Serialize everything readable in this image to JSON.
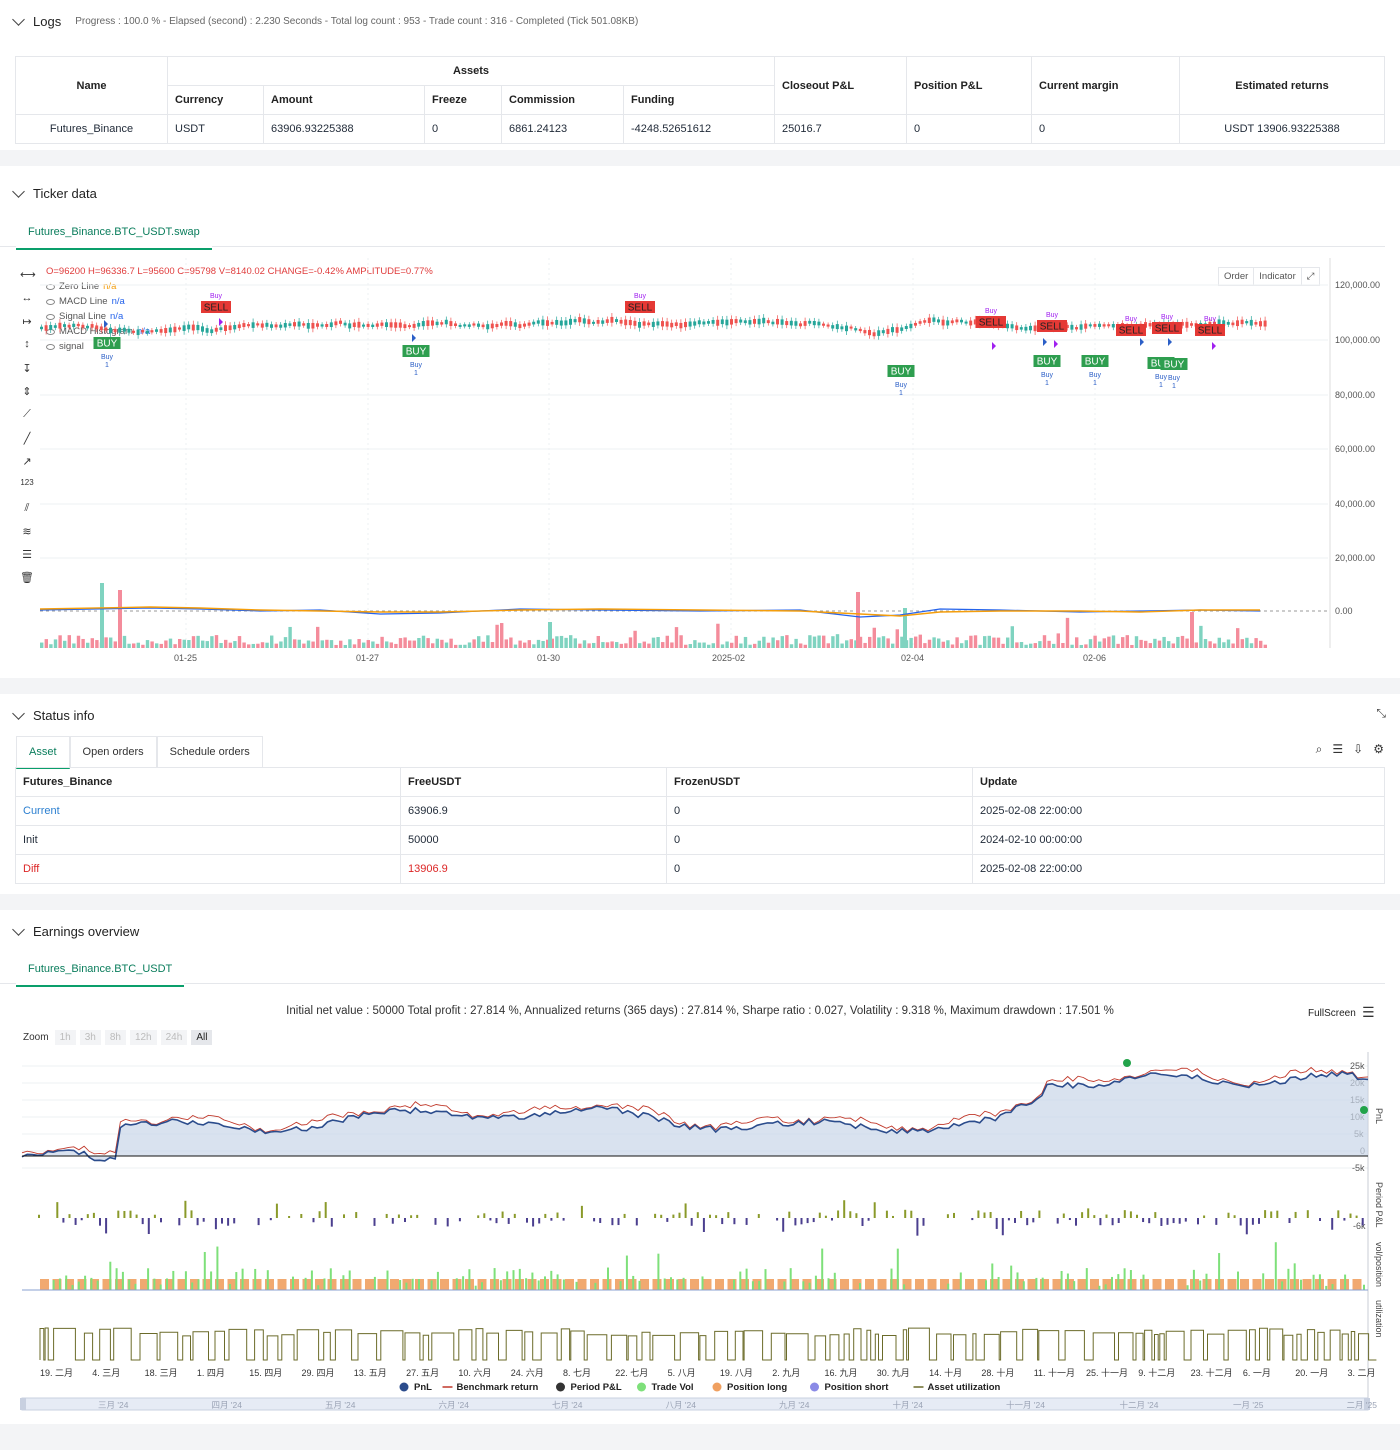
{
  "logs": {
    "title": "Logs",
    "status": "Progress : 100.0 % - Elapsed (second) : 2.230  Seconds - Total log count : 953 - Trade count : 316 - Completed (Tick 501.08KB)"
  },
  "assets_table": {
    "group_header": "Assets",
    "headers": {
      "name": "Name",
      "currency": "Currency",
      "amount": "Amount",
      "freeze": "Freeze",
      "commission": "Commission",
      "funding": "Funding",
      "closeout": "Closeout P&L",
      "position": "Position P&L",
      "margin": "Current margin",
      "returns": "Estimated returns"
    },
    "row": {
      "name": "Futures_Binance",
      "currency": "USDT",
      "amount": "63906.93225388",
      "freeze": "0",
      "commission": "6861.24123",
      "funding": "-4248.52651612",
      "closeout": "25016.7",
      "position": "0",
      "margin": "0",
      "returns": "USDT 13906.93225388"
    }
  },
  "ticker": {
    "title": "Ticker data",
    "tab": "Futures_Binance.BTC_USDT.swap",
    "ohlc": "O=96200 H=96336.7 L=95600 C=95798 V=8140.02 CHANGE=-0.42% AMPLITUDE=0.77%",
    "legend": [
      {
        "label": "Zero Line",
        "value": "n/a",
        "color": "#f59e0b"
      },
      {
        "label": "MACD Line",
        "value": "n/a",
        "color": "#2563eb"
      },
      {
        "label": "Signal Line",
        "value": "n/a",
        "color": "#2563eb"
      },
      {
        "label": "MACD Histogram",
        "value": "n/a",
        "color": "#2563eb"
      },
      {
        "label": "signal",
        "value": "",
        "color": "#555"
      }
    ],
    "buttons": {
      "order": "Order",
      "indicator": "Indicator"
    },
    "y_ticks": [
      "120,000.00",
      "100,000.00",
      "80,000.00",
      "60,000.00",
      "40,000.00",
      "20,000.00",
      "0.00"
    ],
    "x_ticks": [
      "01-25",
      "01-27",
      "01-30",
      "2025-02",
      "02-04",
      "02-06"
    ],
    "labels": {
      "buy": "BUY",
      "sell": "SELL",
      "buy_small": "Buy",
      "one": "1"
    }
  },
  "status": {
    "title": "Status info",
    "tabs": [
      "Asset",
      "Open orders",
      "Schedule orders"
    ],
    "headers": [
      "Futures_Binance",
      "FreeUSDT",
      "FrozenUSDT",
      "Update"
    ],
    "rows": [
      {
        "name": "Current",
        "free": "63906.9",
        "frozen": "0",
        "update": "2025-02-08 22:00:00"
      },
      {
        "name": "Init",
        "free": "50000",
        "frozen": "0",
        "update": "2024-02-10 00:00:00"
      },
      {
        "name": "Diff",
        "free": "13906.9",
        "frozen": "0",
        "update": "2025-02-08 22:00:00"
      }
    ]
  },
  "earnings": {
    "title": "Earnings overview",
    "tab": "Futures_Binance.BTC_USDT",
    "summary": "Initial net value : 50000  Total profit : 27.814 %, Annualized returns (365 days) : 27.814 %, Sharpe ratio : 0.027, Volatility : 9.318 %, Maximum drawdown : 17.501 %",
    "fullscreen": "FullScreen",
    "zoom_label": "Zoom",
    "zoom": [
      "1h",
      "3h",
      "8h",
      "12h",
      "24h",
      "All"
    ],
    "pnl_ticks": [
      "25k",
      "20k",
      "15k",
      "10k",
      "5k",
      "0",
      "-5k"
    ],
    "pnl_axis": "PnL",
    "period_axis": "Period P&L",
    "period_tick": "-6k",
    "vol_axis": "vol/position",
    "util_axis": "utilization",
    "x_ticks": [
      "19. 二月",
      "4. 三月",
      "18. 三月",
      "1. 四月",
      "15. 四月",
      "29. 四月",
      "13. 五月",
      "27. 五月",
      "10. 六月",
      "24. 六月",
      "8. 七月",
      "22. 七月",
      "5. 八月",
      "19. 八月",
      "2. 九月",
      "16. 九月",
      "30. 九月",
      "14. 十月",
      "28. 十月",
      "11. 十一月",
      "25. 十一月",
      "9. 十二月",
      "23. 十二月",
      "6. 一月",
      "20. 一月",
      "3. 二月"
    ],
    "legend": [
      {
        "label": "PnL",
        "color": "#2b4c8c"
      },
      {
        "label": "Benchmark return",
        "color": "#c0392b"
      },
      {
        "label": "Period P&L",
        "color": "#333333"
      },
      {
        "label": "Trade Vol",
        "color": "#7ee07a"
      },
      {
        "label": "Position long",
        "color": "#f0a060"
      },
      {
        "label": "Position short",
        "color": "#8a8ae6"
      },
      {
        "label": "Asset utilization",
        "color": "#6b6b2a"
      }
    ],
    "navigator": [
      "三月 '24",
      "四月 '24",
      "五月 '24",
      "六月 '24",
      "七月 '24",
      "八月 '24",
      "九月 '24",
      "十月 '24",
      "十一月 '24",
      "十二月 '24",
      "一月 '25",
      "二月 '25"
    ]
  }
}
